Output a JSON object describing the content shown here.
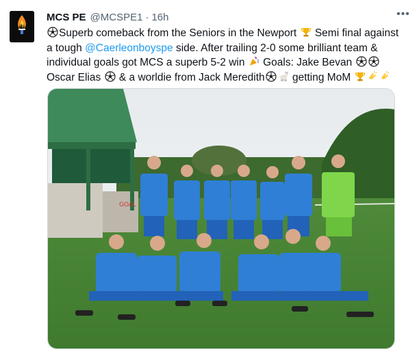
{
  "tweet": {
    "name": "MCS PE",
    "handle": "@MCSPE1",
    "separator": "·",
    "time": "16h",
    "more_label": "•••",
    "text": {
      "p1": "Superb comeback from the Seniors in the Newport ",
      "p2": " Semi final against a tough ",
      "mention": "@Caerleonboyspe",
      "p3": " side. After trailing 2-0 some brilliant team & individual goals got MCS a superb 5-2 win ",
      "p4": " Goals: Jake Bevan ",
      "p5": " Oscar Elias ",
      "p6": " & a worldie from Jack Meredith",
      "p7": " getting MoM "
    }
  },
  "avatar": {
    "caption": "PHYSICAL EDUCATION"
  },
  "icons": [
    "soccer-ball-icon",
    "trophy-icon",
    "party-popper-icon",
    "goat-icon",
    "clapping-hands-icon",
    "more-icon"
  ],
  "colors": {
    "link": "#1d9bf0",
    "text": "#0f1419",
    "secondary": "#536471",
    "border": "#cfd9de"
  }
}
